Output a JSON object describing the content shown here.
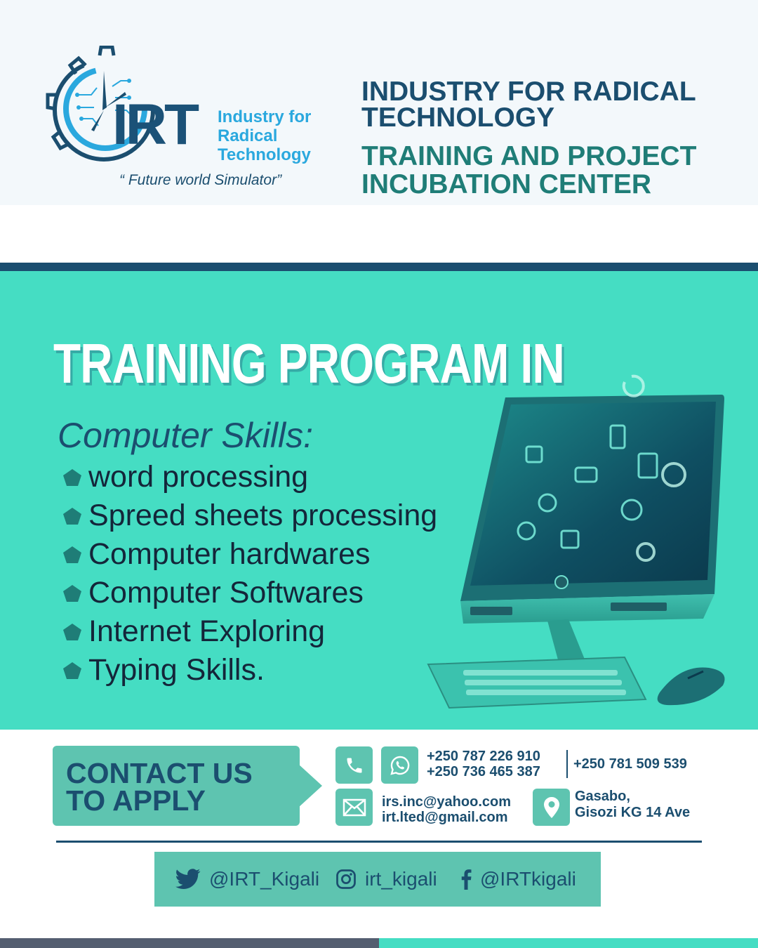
{
  "brand": {
    "logo_mark": "IRT",
    "logo_name": [
      "Industry for",
      "Radical",
      "Technology"
    ],
    "tagline": "“ Future world Simulator”"
  },
  "header": {
    "title_lines": [
      "INDUSTRY FOR RADICAL",
      "TECHNOLOGY"
    ],
    "subtitle_lines": [
      "TRAINING AND PROJECT",
      "INCUBATION CENTER"
    ]
  },
  "program": {
    "title": "TRAINING PROGRAM IN",
    "heading": "Computer Skills:",
    "skills": [
      "word processing",
      "Spreed sheets processing",
      "Computer hardwares",
      "Computer Softwares",
      "Internet Exploring",
      "Typing Skills."
    ]
  },
  "contact": {
    "cta_lines": [
      "CONTACT US",
      "TO APPLY"
    ],
    "phones": [
      "+250 787 226 910",
      "+250 736 465 387"
    ],
    "phone_extra": "+250 781 509 539",
    "emails": [
      "irs.inc@yahoo.com",
      "irt.lted@gmail.com"
    ],
    "address_lines": [
      "Gasabo,",
      "Gisozi KG 14 Ave"
    ],
    "icons": [
      "phone-icon",
      "whatsapp-icon",
      "email-icon",
      "location-icon"
    ]
  },
  "social": {
    "twitter": "@IRT_Kigali",
    "instagram": "irt_kigali",
    "facebook": "@IRTkigali"
  },
  "colors": {
    "navy": "#1b4e6f",
    "teal": "#45ddc3",
    "tile": "#5ec4b0",
    "brand_blue": "#2aa8de",
    "green_text": "#1f7d77"
  }
}
